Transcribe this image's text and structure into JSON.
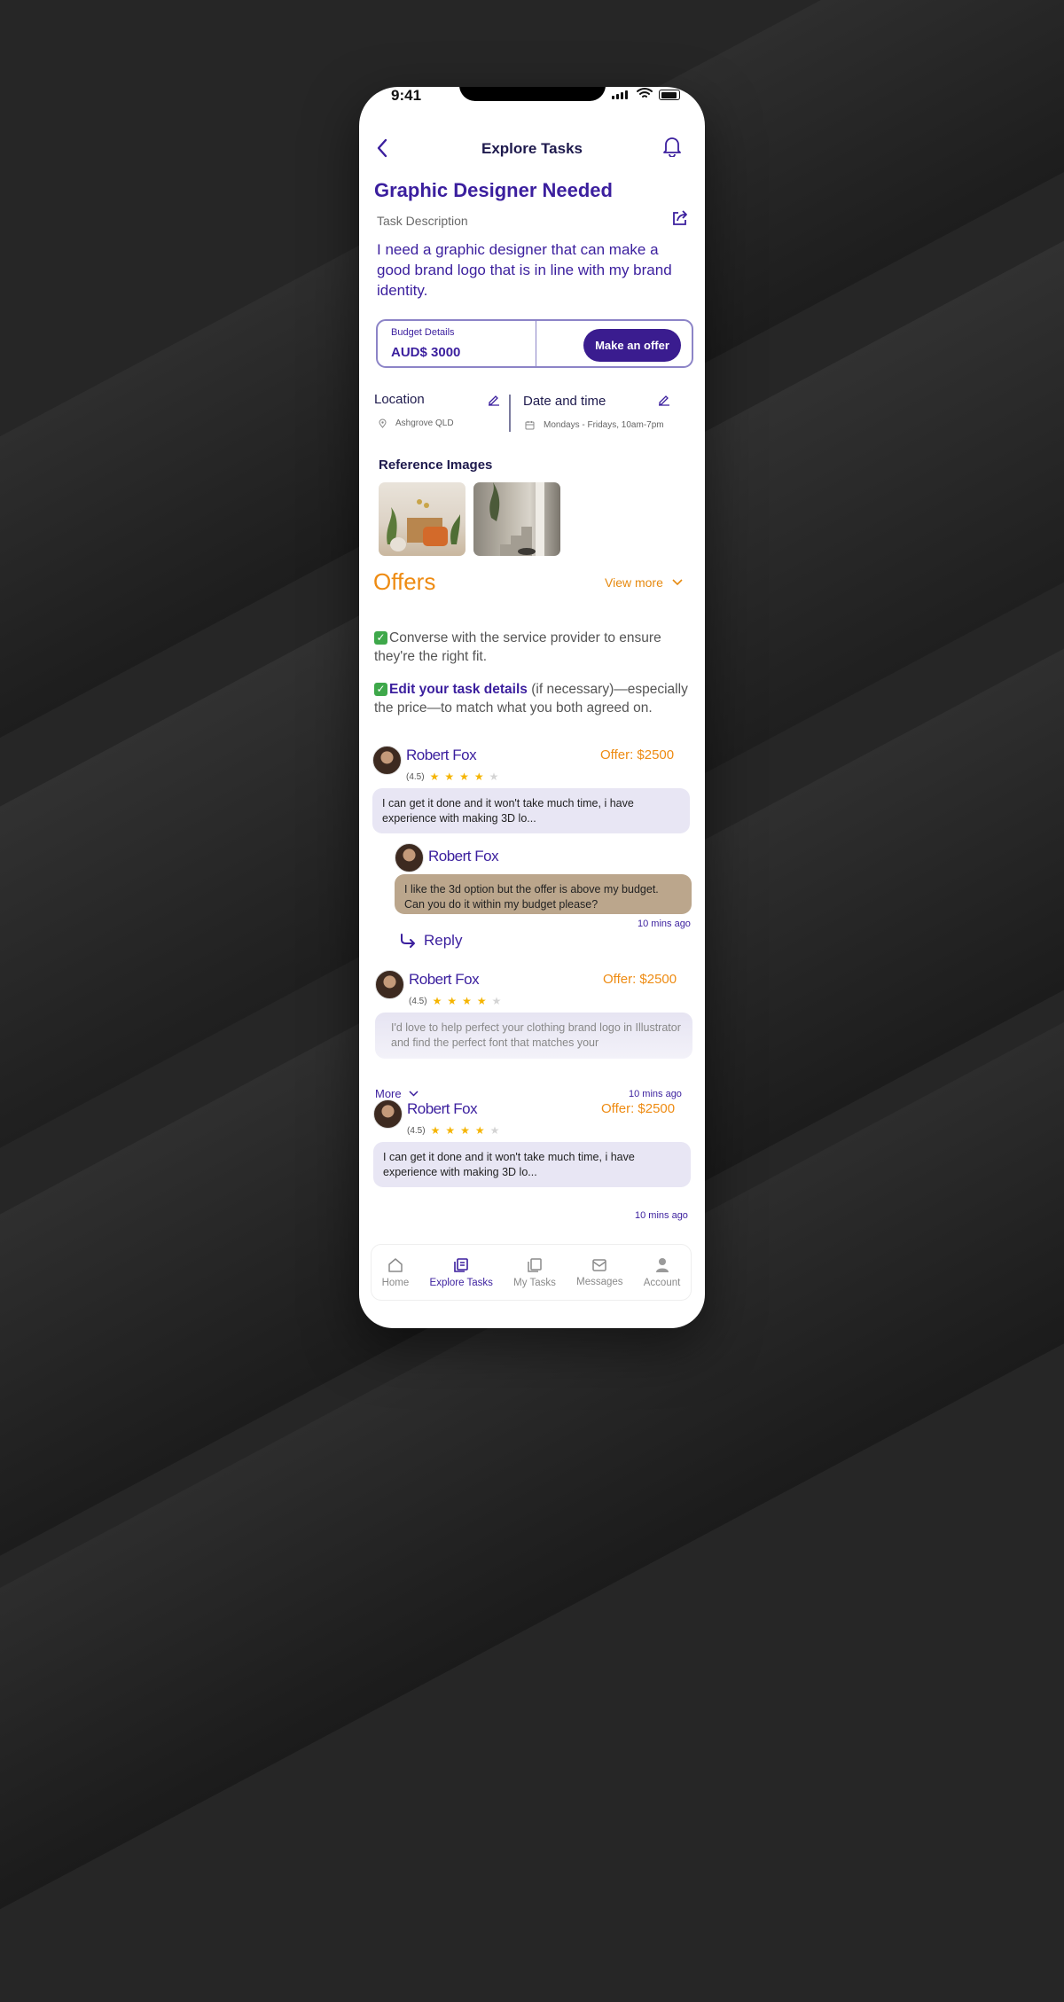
{
  "status_bar": {
    "time": "9:41"
  },
  "header": {
    "title": "Explore Tasks"
  },
  "task": {
    "title": "Graphic Designer Needed",
    "description_label": "Task Description",
    "description": "I need a graphic designer that can make a good brand logo that is in line with my brand identity."
  },
  "budget": {
    "label": "Budget Details",
    "value": "AUD$ 3000",
    "action": "Make an offer"
  },
  "location": {
    "label": "Location",
    "value": "Ashgrove QLD"
  },
  "datetime": {
    "label": "Date and time",
    "value": "Mondays - Fridays, 10am-7pm"
  },
  "reference": {
    "label": "Reference Images"
  },
  "offers": {
    "title": "Offers",
    "view_more": "View more",
    "tip1": "Converse with the service provider to ensure they're the right fit.",
    "tip2_strong": "Edit your task details",
    "tip2_rest": " (if necessary)—especially the price—to match what you both agreed on.",
    "items": [
      {
        "name": "Robert Fox",
        "price": "Offer: $2500",
        "rating": "(4.5)",
        "stars": 4.5,
        "message": "I can get it done and it won't take much time, i have experience with making 3D lo..."
      },
      {
        "name": "Robert Fox",
        "price": "Offer: $2500",
        "rating": "(4.5)",
        "stars": 4.5,
        "message": "I'd love to help perfect your clothing brand logo in Illustrator and find the perfect font that matches your",
        "more": "More",
        "time": "10 mins ago"
      },
      {
        "name": "Robert Fox",
        "price": "Offer: $2500",
        "rating": "(4.5)",
        "stars": 4.5,
        "message": "I can get it done and it won't take much time, i have experience with making 3D lo...",
        "time": "10 mins ago"
      }
    ],
    "reply_thread": {
      "name": "Robert Fox",
      "message": "I like the 3d option but the offer is above my budget. Can you do it within my budget please?",
      "time": "10 mins ago",
      "reply_label": "Reply"
    }
  },
  "tabs": [
    {
      "label": "Home",
      "icon": "home-icon",
      "active": false
    },
    {
      "label": "Explore Tasks",
      "icon": "explore-tasks-icon",
      "active": true
    },
    {
      "label": "My Tasks",
      "icon": "my-tasks-icon",
      "active": false
    },
    {
      "label": "Messages",
      "icon": "mail-icon",
      "active": false
    },
    {
      "label": "Account",
      "icon": "user-icon",
      "active": false
    }
  ],
  "colors": {
    "primary": "#3b1f9e",
    "accent": "#ee8b12",
    "bubble": "#e8e6f4",
    "bubble_alt": "#bba68c"
  }
}
